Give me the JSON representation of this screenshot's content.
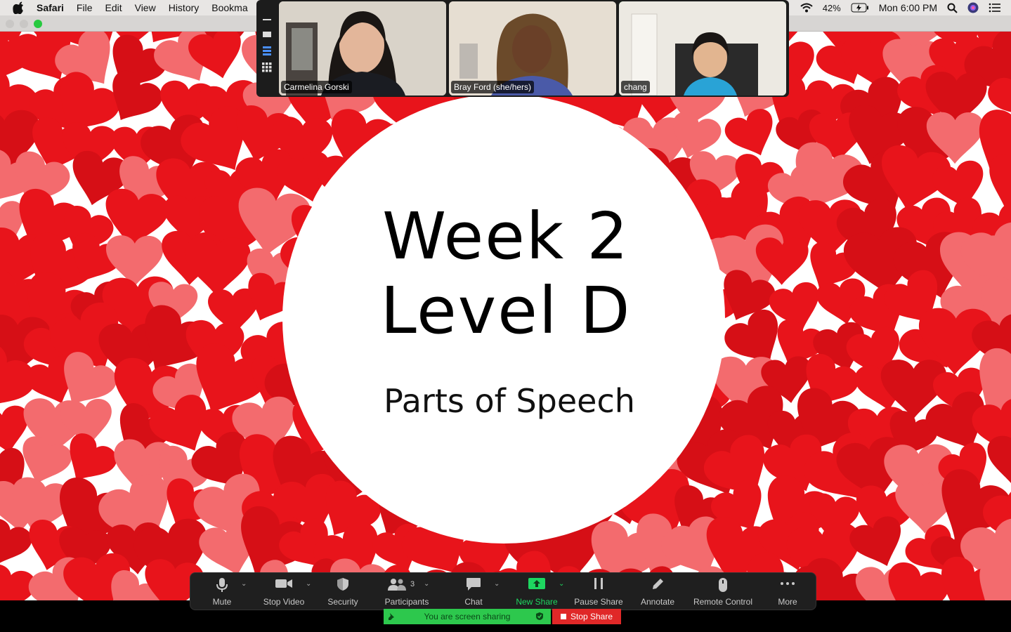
{
  "menubar": {
    "app": "Safari",
    "items": [
      "File",
      "Edit",
      "View",
      "History",
      "Bookma"
    ],
    "battery": "42%",
    "clock": "Mon 6:00 PM"
  },
  "slide": {
    "title_line1": "Week 2",
    "title_line2": "Level D",
    "subtitle": "Parts of Speech"
  },
  "participants": [
    {
      "name": "Carmelina Gorski"
    },
    {
      "name": "Bray Ford (she/hers)"
    },
    {
      "name": "chang"
    }
  ],
  "toolbar": {
    "mute": "Mute",
    "stop_video": "Stop Video",
    "security": "Security",
    "participants": "Participants",
    "participants_count": "3",
    "chat": "Chat",
    "new_share": "New Share",
    "pause_share": "Pause Share",
    "annotate": "Annotate",
    "remote_control": "Remote Control",
    "more": "More"
  },
  "sharing_status": "You are screen sharing",
  "stop_share": "Stop Share",
  "colors": {
    "heart_red": "#e8141b",
    "heart_pink": "#f36b6e",
    "active_green": "#2bd14c",
    "stop_red": "#e02828"
  }
}
